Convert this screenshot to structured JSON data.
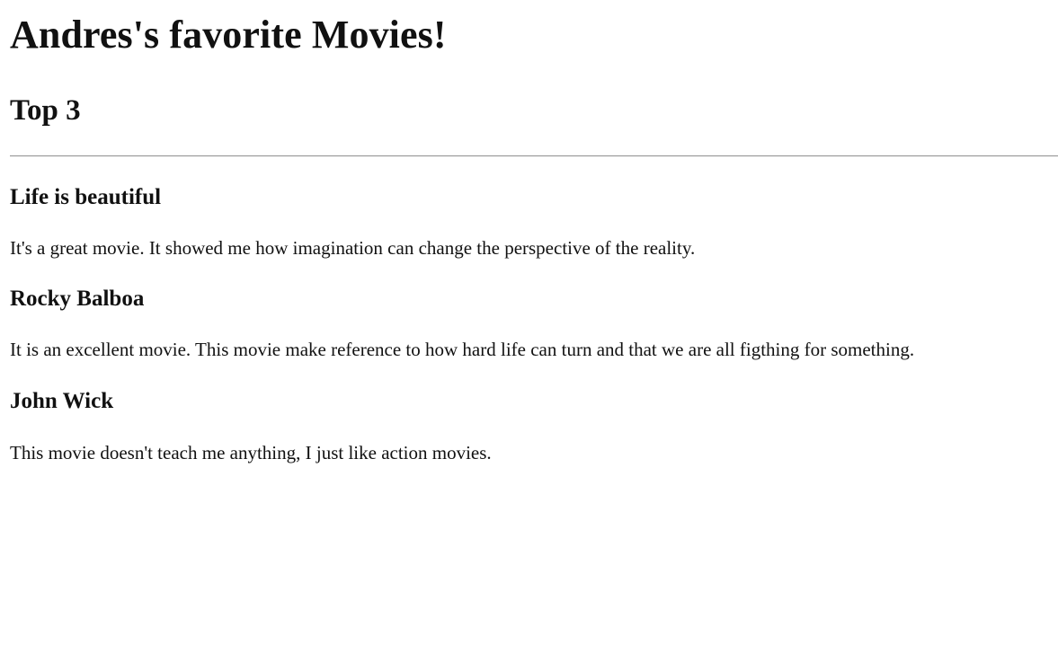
{
  "header": {
    "title": "Andres's favorite Movies!",
    "subtitle": "Top 3"
  },
  "movies": [
    {
      "title": "Life is beautiful",
      "description": "It's a great movie. It showed me how imagination can change the perspective of the reality."
    },
    {
      "title": "Rocky Balboa",
      "description": "It is an excellent movie. This movie make reference to how hard life can turn and that we are all figthing for something."
    },
    {
      "title": "John Wick",
      "description": "This movie doesn't teach me anything, I just like action movies."
    }
  ]
}
